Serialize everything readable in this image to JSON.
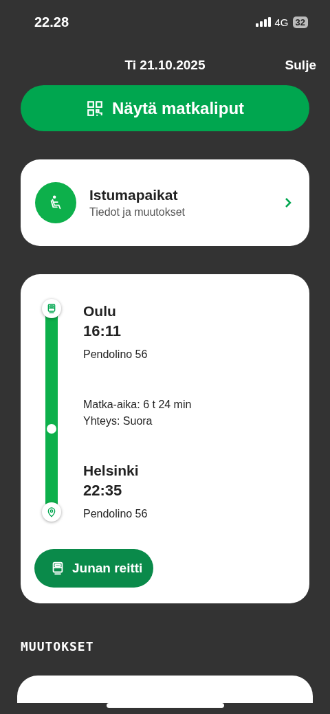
{
  "status_bar": {
    "time": "22.28",
    "network": "4G",
    "battery": "32"
  },
  "header": {
    "date": "Ti 21.10.2025",
    "close": "Sulje"
  },
  "tickets_button": {
    "label": "Näytä matkaliput"
  },
  "seats_card": {
    "title": "Istumapaikat",
    "subtitle": "Tiedot ja muutokset"
  },
  "journey": {
    "stops": [
      {
        "kind": "origin",
        "station": "Oulu",
        "time": "16:11",
        "train": "Pendolino 56"
      },
      {
        "kind": "info",
        "lines": [
          "Matka-aika: 6 t 24 min",
          "Yhteys: Suora"
        ]
      },
      {
        "kind": "destination",
        "station": "Helsinki",
        "time": "22:35",
        "train": "Pendolino 56"
      }
    ],
    "route_button": {
      "label": "Junan reitti"
    }
  },
  "changes": {
    "heading": "MUUTOKSET"
  }
}
